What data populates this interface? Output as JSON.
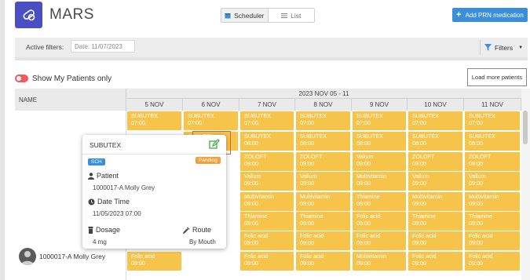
{
  "app": {
    "title": "MARS"
  },
  "views": {
    "scheduler": "Scheduler",
    "list": "List"
  },
  "actions": {
    "add_prn": "Add PRN medication",
    "load_more": "Load more patients",
    "filters": "Filters"
  },
  "filters": {
    "label": "Active filters:",
    "date_value": "Date: 11/07/2023"
  },
  "toggle": {
    "label": "Show My Patients only",
    "on": false
  },
  "grid": {
    "name_header": "NAME",
    "week_label": "2023 NOV 05 - 11",
    "days": [
      "5 NOV",
      "6 NOV",
      "7 NOV",
      "8 NOV",
      "9 NOV",
      "10 NOV",
      "11 NOV"
    ]
  },
  "patient": {
    "name": "1000017-A Molly Grey"
  },
  "rows": [
    [
      "SUBUTEX|07:00",
      "SUBUTEX|07:00",
      "SUBUTEX|07:00",
      "SUBUTEX|07:00",
      "SUBUTEX|07:00",
      "SUBUTEX|07:00",
      "SUBUTEX|07:00"
    ],
    [
      "",
      "SUBUTEX|08:00",
      "SUBUTEX|08:00",
      "SUBUTEX|08:00",
      "SUBUTEX|08:00",
      "SUBUTEX|08:00",
      "SUBUTEX|08:00"
    ],
    [
      "",
      "",
      "ZOLOFT|09:00",
      "ZOLOFT|09:00",
      "Valium|09:00",
      "ZOLOFT|09:00",
      "ZOLOFT|09:00"
    ],
    [
      "",
      "",
      "Valium|09:00",
      "Valium|09:00",
      "Multivitamin|09:00",
      "Valium|09:00",
      "Valium|09:00"
    ],
    [
      "",
      "",
      "Multivitamin|09:00",
      "Multivitamin|09:00",
      "Thiamine|09:00",
      "Multivitamin|09:00",
      "Multivitamin|09:00"
    ],
    [
      "",
      "",
      "Thiamine|09:00",
      "Thiamine|09:00",
      "Folic acid|09:00",
      "Thiamine|09:00",
      "Thiamine|09:00"
    ],
    [
      "",
      "",
      "Folic acid|09:00",
      "Folic acid|09:00",
      "Folic acid|09:00",
      "Folic acid|09:00",
      "Folic acid|09:00"
    ],
    [
      "Folic acid|09:00",
      "",
      "Folic acid|09:00",
      "Folic acid|09:00",
      "Multivitamin|09:00",
      "Folic acid|09:00",
      "Folic acid|09:00"
    ]
  ],
  "popup": {
    "title": "SUBUTEX",
    "badge_type": "SCH",
    "status": "Pending",
    "patient_label": "Patient",
    "patient_value": "1000017-A Molly Grey",
    "datetime_label": "Date Time",
    "datetime_value": "11/05/2023 07:00",
    "dosage_label": "Dosage",
    "dosage_value": "4 mg",
    "route_label": "Route",
    "route_value": "By Mouth"
  },
  "colors": {
    "accent": "#3b8fd9",
    "brand": "#4a4fc4",
    "med_cell": "#f6c44a",
    "pending": "#f0a13d",
    "toggle_off": "#f05b5b"
  }
}
